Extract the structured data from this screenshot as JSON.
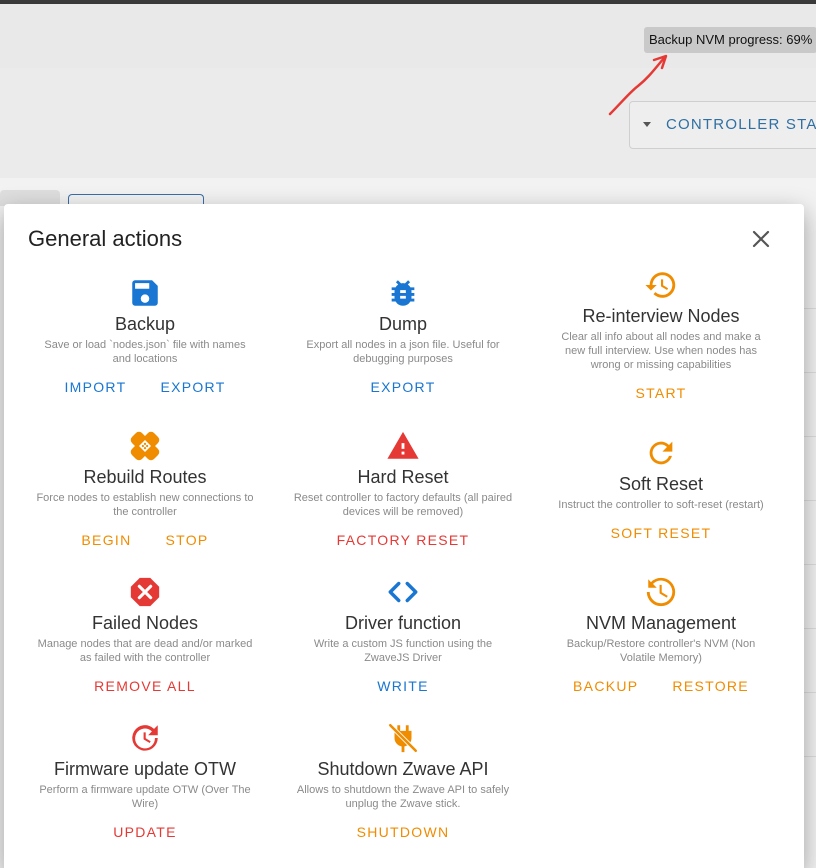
{
  "header": {
    "progress_text": "Backup NVM progress: 69%"
  },
  "controller": {
    "label": "CONTROLLER STAT"
  },
  "dialog": {
    "title": "General actions",
    "actions": [
      {
        "title": "Backup",
        "desc": "Save or load `nodes.json` file with names and locations",
        "buttons": [
          "IMPORT",
          "EXPORT"
        ],
        "icon": "save-icon",
        "color": "#1976d2"
      },
      {
        "title": "Dump",
        "desc": "Export all nodes in a json file. Useful for debugging purposes",
        "buttons": [
          "EXPORT"
        ],
        "icon": "bug-icon",
        "color": "#1976d2"
      },
      {
        "title": "Re-interview Nodes",
        "desc": "Clear all info about all nodes and make a new full interview. Use when nodes has wrong or missing capabilities",
        "buttons": [
          "START"
        ],
        "icon": "history-icon",
        "color": "#f08c00"
      },
      {
        "title": "Rebuild Routes",
        "desc": "Force nodes to establish new connections to the controller",
        "buttons": [
          "BEGIN",
          "STOP"
        ],
        "icon": "bandage-icon",
        "color": "#f08c00"
      },
      {
        "title": "Hard Reset",
        "desc": "Reset controller to factory defaults (all paired devices will be removed)",
        "buttons": [
          "FACTORY RESET"
        ],
        "icon": "warning-icon",
        "color": "#e53935"
      },
      {
        "title": "Soft Reset",
        "desc": "Instruct the controller to soft-reset (restart)",
        "buttons": [
          "SOFT RESET"
        ],
        "icon": "refresh-icon",
        "color": "#f08c00"
      },
      {
        "title": "Failed Nodes",
        "desc": "Manage nodes that are dead and/or marked as failed with the controller",
        "buttons": [
          "REMOVE ALL"
        ],
        "icon": "close-octagon-icon",
        "color": "#e53935"
      },
      {
        "title": "Driver function",
        "desc": "Write a custom JS function using the ZwaveJS Driver",
        "buttons": [
          "WRITE"
        ],
        "icon": "code-icon",
        "color": "#1976d2"
      },
      {
        "title": "NVM Management",
        "desc": "Backup/Restore controller's NVM (Non Volatile Memory)",
        "buttons": [
          "BACKUP",
          "RESTORE"
        ],
        "icon": "history-clock-icon",
        "color": "#f08c00"
      },
      {
        "title": "Firmware update OTW",
        "desc": "Perform a firmware update OTW (Over The Wire)",
        "buttons": [
          "UPDATE"
        ],
        "icon": "update-icon",
        "color": "#e53935"
      },
      {
        "title": "Shutdown Zwave API",
        "desc": "Allows to shutdown the Zwave API to safely unplug the Zwave stick.",
        "buttons": [
          "SHUTDOWN"
        ],
        "icon": "power-plug-off-icon",
        "color": "#f08c00"
      }
    ]
  }
}
